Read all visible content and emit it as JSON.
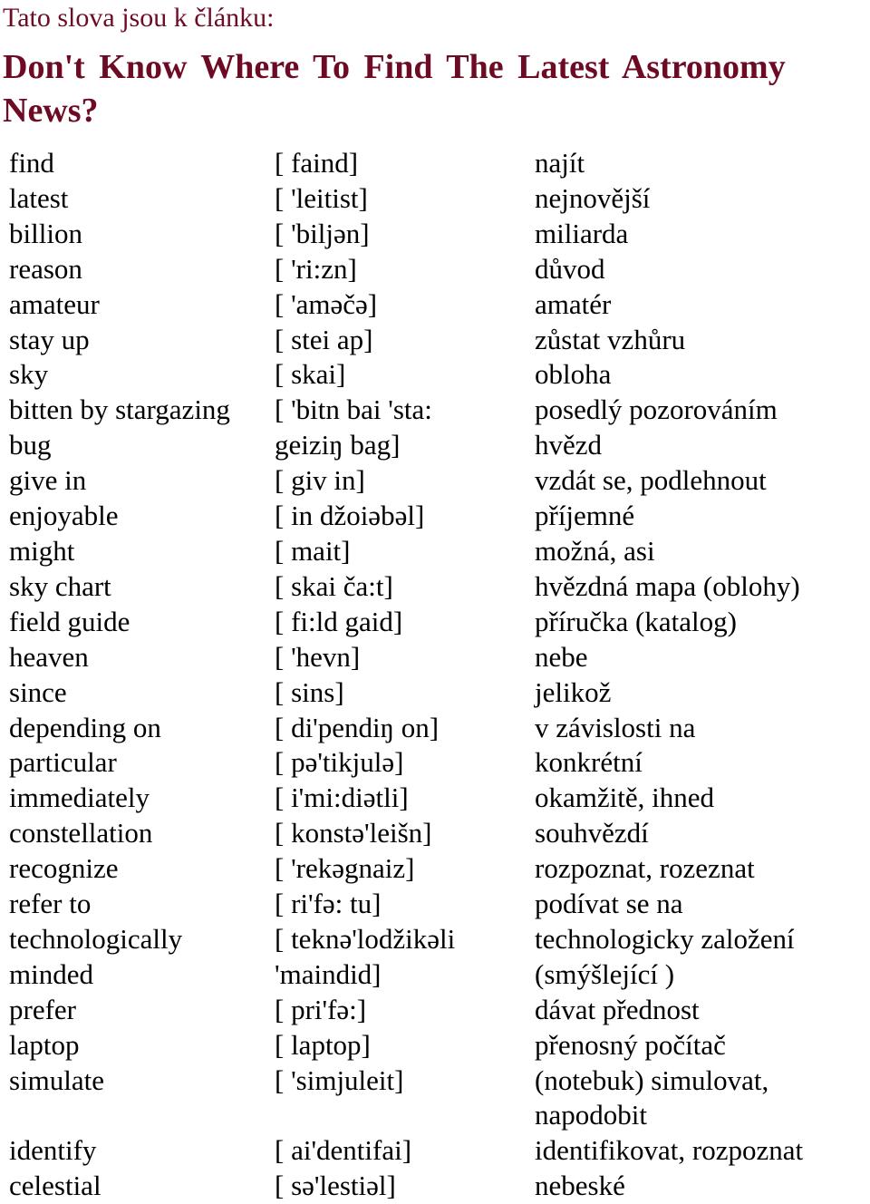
{
  "subtitle": "Tato slova jsou k článku:",
  "heading": "Don't Know Where To Find The Latest Astronomy News?",
  "colors": {
    "heading": "#6e0b24",
    "text": "#000000"
  },
  "vocabulary": [
    {
      "word": "find",
      "pron": "[ faind]",
      "trans": "najít"
    },
    {
      "word": "latest",
      "pron": "[ 'leitist]",
      "trans": "nejnovější"
    },
    {
      "word": "billion",
      "pron": "[ 'biljən]",
      "trans": "miliarda"
    },
    {
      "word": "reason",
      "pron": "[ 'ri:zn]",
      "trans": "důvod"
    },
    {
      "word": "amateur",
      "pron": "[ 'aməčə]",
      "trans": "amatér"
    },
    {
      "word": "stay up",
      "pron": "[ stei ap]",
      "trans": "zůstat vzhůru"
    },
    {
      "word": "sky",
      "pron": "[ skai]",
      "trans": "obloha"
    },
    {
      "word": "bitten by stargazing",
      "pron": "[ 'bitn bai 'sta:",
      "trans": "posedlý pozorováním"
    },
    {
      "word": "bug",
      "pron": "geiziŋ bag]",
      "trans": "hvězd"
    },
    {
      "word": "give in",
      "pron": "[ giv in]",
      "trans": "vzdát se, podlehnout"
    },
    {
      "word": "enjoyable",
      "pron": "[ in džoiəbəl]",
      "trans": "příjemné"
    },
    {
      "word": "might",
      "pron": "[ mait]",
      "trans": "možná, asi"
    },
    {
      "word": "sky chart",
      "pron": "[ skai ča:t]",
      "trans": "hvězdná mapa (oblohy)"
    },
    {
      "word": "field guide",
      "pron": "[ fi:ld gaid]",
      "trans": "příručka (katalog)"
    },
    {
      "word": "heaven",
      "pron": "[ 'hevn]",
      "trans": "nebe"
    },
    {
      "word": "since",
      "pron": "[ sins]",
      "trans": "jelikož"
    },
    {
      "word": "depending on",
      "pron": "[ di'pendiŋ on]",
      "trans": "v závislosti na"
    },
    {
      "word": "particular",
      "pron": "[ pə'tikjulə]",
      "trans": "konkrétní"
    },
    {
      "word": "immediately",
      "pron": "[ i'mi:diətli]",
      "trans": "okamžitě, ihned"
    },
    {
      "word": "constellation",
      "pron": "[ konstə'leišn]",
      "trans": "souhvězdí"
    },
    {
      "word": "recognize",
      "pron": "[ 'rekəgnaiz]",
      "trans": "rozpoznat, rozeznat"
    },
    {
      "word": "refer to",
      "pron": "[ ri'fə: tu]",
      "trans": "podívat se na"
    },
    {
      "word": "technologically",
      "pron": "[ teknə'lodžikəli",
      "trans": "technologicky založení"
    },
    {
      "word": "minded",
      "pron": "'maindid]",
      "trans": "(smýšlející )"
    },
    {
      "word": "prefer",
      "pron": "[ pri'fə:]",
      "trans": "dávat přednost"
    },
    {
      "word": "laptop",
      "pron": "[ laptop]",
      "trans": "přenosný počítač"
    },
    {
      "word": "simulate",
      "pron": "[ 'simjuleit]",
      "trans": "(notebuk) simulovat, napodobit"
    },
    {
      "word": "identify",
      "pron": "[ ai'dentifai]",
      "trans": "identifikovat, rozpoznat"
    },
    {
      "word": "celestial",
      "pron": "[ sə'lestiəl]",
      "trans": "nebeské"
    }
  ]
}
